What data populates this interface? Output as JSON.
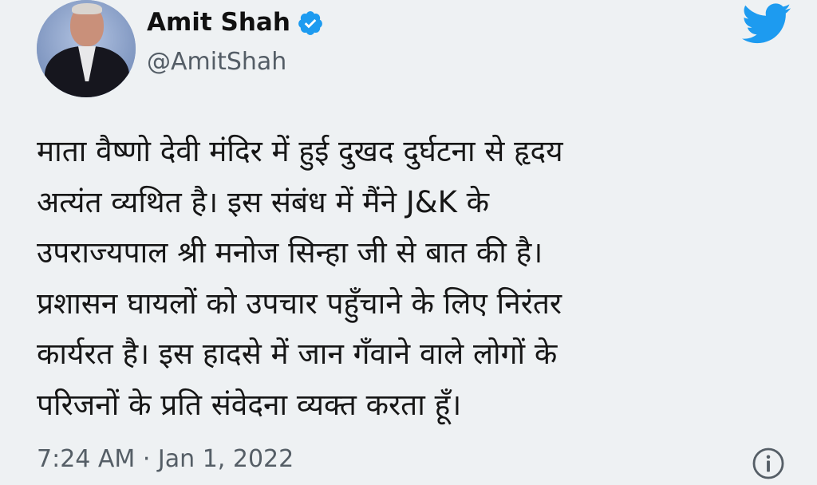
{
  "tweet": {
    "author_name": "Amit Shah",
    "handle": "@AmitShah",
    "verified": true,
    "text_lines": [
      "माता वैष्णो देवी मंदिर में हुई दुखद दुर्घटना से हृदय",
      "अत्यंत व्यथित है। इस संबंध में मैंने J&K के",
      "उपराज्यपाल श्री मनोज सिन्हा जी से बात की है।",
      "प्रशासन घायलों को उपचार पहुँचाने के लिए निरंतर",
      "कार्यरत है। इस हादसे में जान गँवाने वाले लोगों के",
      "परिजनों के प्रति संवेदना व्यक्त करता हूँ।"
    ],
    "timestamp": "7:24 AM · Jan 1, 2022"
  },
  "icons": {
    "verified": "verified-badge-icon",
    "brand": "twitter-bird-icon",
    "info": "info-icon"
  },
  "colors": {
    "background": "#eef1f3",
    "twitter_blue": "#1d9bf0",
    "text": "#161616",
    "secondary_text": "#555e66"
  }
}
